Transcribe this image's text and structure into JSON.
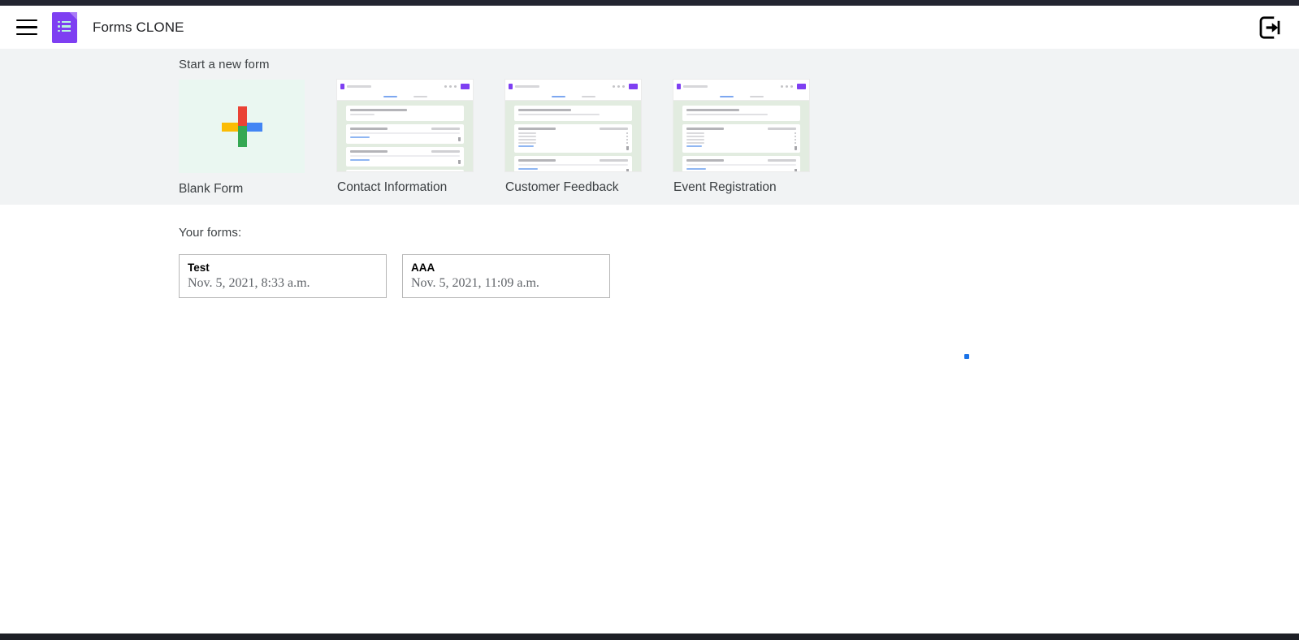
{
  "header": {
    "menu_icon": "hamburger-menu-icon",
    "logo_icon": "google-forms-icon",
    "app_title": "Forms CLONE",
    "logout_icon": "logout-exit-icon"
  },
  "templates": {
    "heading": "Start a new form",
    "items": [
      {
        "label": "Blank Form",
        "type": "blank",
        "icon": "google-plus-icon"
      },
      {
        "label": "Contact Information",
        "type": "thumbnail"
      },
      {
        "label": "Customer Feedback",
        "type": "thumbnail"
      },
      {
        "label": "Event Registration",
        "type": "thumbnail"
      }
    ]
  },
  "your_forms": {
    "heading": "Your forms:",
    "cards": [
      {
        "title": "Test",
        "date": "Nov. 5, 2021, 8:33 a.m."
      },
      {
        "title": "AAA",
        "date": "Nov. 5, 2021, 11:09 a.m."
      }
    ]
  },
  "colors": {
    "brand_purple": "#7e3ff2",
    "banner_bg": "#f1f3f4",
    "blank_tile_bg": "#eaf7f1",
    "plus_red": "#ea4335",
    "plus_yellow": "#fbbc04",
    "plus_blue": "#4285f4",
    "plus_green": "#34a853",
    "cursor_dot": "#1a73e8"
  }
}
